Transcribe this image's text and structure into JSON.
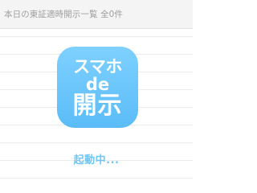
{
  "header": {
    "title": "本日の東証適時開示一覧 全0件"
  },
  "logo": {
    "line1": "スマホ",
    "line2": "de",
    "line3": "開示"
  },
  "status": {
    "loading_text": "起動中..."
  },
  "colors": {
    "logo_bg": "#6ec6f5",
    "loading_text": "#6ec6f5",
    "header_bg": "#f4f4f4",
    "header_text": "#9e9e9e"
  }
}
